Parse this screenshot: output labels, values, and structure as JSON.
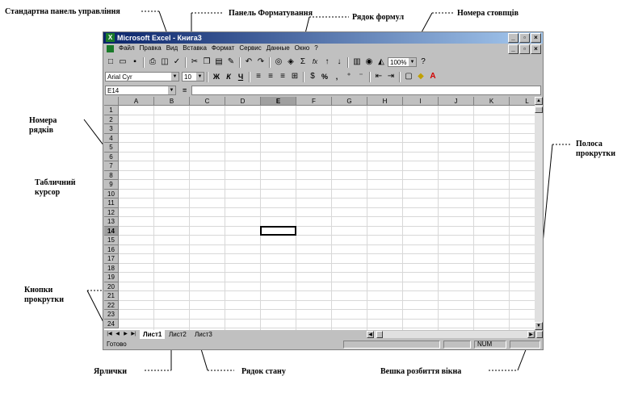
{
  "annotations": {
    "standard_toolbar": "Стандартна панель управління",
    "format_toolbar": "Панель Форматування",
    "formula_bar": "Рядок формул",
    "column_numbers": "Номера стовпців",
    "row_numbers": "Номера\nрядків",
    "table_cursor": "Табличний\nкурсор",
    "scroll_bar": "Полоса\nпрокрутки",
    "scroll_buttons": "Кнопки\nпрокрутки",
    "sheet_tabs": "Ярлички",
    "status_bar": "Рядок стану",
    "split_marker": "Вешка розбиття вікна"
  },
  "window": {
    "title": "Microsoft Excel - Книга3",
    "menu": [
      "Файл",
      "Правка",
      "Вид",
      "Вставка",
      "Формат",
      "Сервис",
      "Данные",
      "Окно",
      "?"
    ]
  },
  "toolbar_std": {
    "zoom": "100%",
    "sigma": "Σ",
    "fx": "fx"
  },
  "toolbar_fmt": {
    "font": "Arial Cyr",
    "size": "10",
    "bold": "Ж",
    "italic": "К",
    "underline": "Ч",
    "percent": "%",
    "comma": ","
  },
  "formula_bar": {
    "name_box": "E14",
    "eq": "="
  },
  "columns": [
    "A",
    "B",
    "C",
    "D",
    "E",
    "F",
    "G",
    "H",
    "I",
    "J",
    "K",
    "L"
  ],
  "rows": [
    "1",
    "2",
    "3",
    "4",
    "5",
    "6",
    "7",
    "8",
    "9",
    "10",
    "11",
    "12",
    "13",
    "14",
    "15",
    "16",
    "17",
    "18",
    "19",
    "20",
    "21",
    "22",
    "23",
    "24"
  ],
  "selection": {
    "column": "E",
    "row": "14"
  },
  "sheets": {
    "tabs": [
      "Лист1",
      "Лист2",
      "Лист3"
    ],
    "active": "Лист1"
  },
  "status": {
    "ready": "Готово",
    "num": "NUM"
  },
  "colors": {
    "title_start": "#0a246a",
    "title_end": "#a6caf0",
    "face": "#c0c0c0"
  }
}
